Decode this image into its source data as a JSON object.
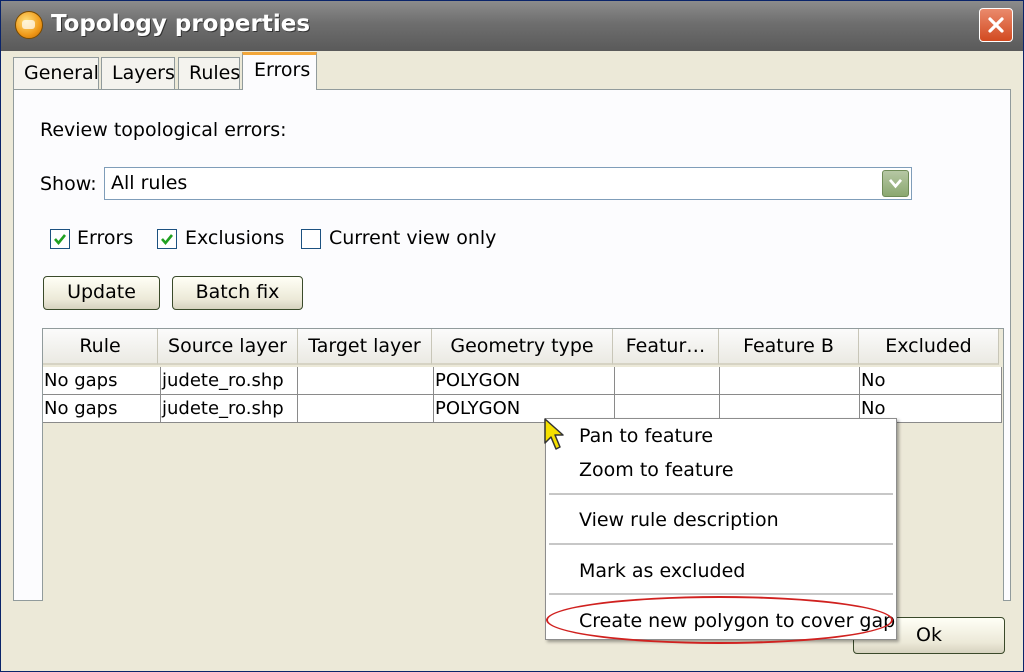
{
  "window": {
    "title": "Topology properties"
  },
  "icons": {
    "app": "app-logo-icon",
    "close": "close-icon",
    "combo_arrow": "chevron-down-icon",
    "check": "checkmark-icon",
    "cursor": "mouse-cursor-icon"
  },
  "tabs": [
    {
      "label": "General",
      "active": false
    },
    {
      "label": "Layers",
      "active": false
    },
    {
      "label": "Rules",
      "active": false
    },
    {
      "label": "Errors",
      "active": true
    }
  ],
  "errors_tab": {
    "heading": "Review topological errors:",
    "show_label": "Show:",
    "show_value": "All rules",
    "checkboxes": [
      {
        "label": "Errors",
        "checked": true
      },
      {
        "label": "Exclusions",
        "checked": true
      },
      {
        "label": "Current view only",
        "checked": false
      }
    ],
    "buttons": {
      "update": "Update",
      "batch_fix": "Batch fix"
    }
  },
  "table": {
    "columns": [
      "Rule",
      "Source layer",
      "Target layer",
      "Geometry type",
      "Featur…",
      "Feature B",
      "Excluded"
    ],
    "rows": [
      [
        "No gaps",
        "judete_ro.shp",
        "",
        "POLYGON",
        "",
        "",
        "No"
      ],
      [
        "No gaps",
        "judete_ro.shp",
        "",
        "POLYGON",
        "",
        "",
        "No"
      ]
    ]
  },
  "context_menu": {
    "items": [
      "Pan to feature",
      "Zoom to feature",
      "View rule description",
      "Mark as excluded",
      "Create new polygon to cover gap"
    ],
    "highlighted_item": "Create new polygon to cover gap"
  },
  "footer": {
    "ok": "Ok"
  },
  "colors": {
    "highlight_ellipse": "#d0211f",
    "tab_active_accent": "#f3a73a"
  }
}
